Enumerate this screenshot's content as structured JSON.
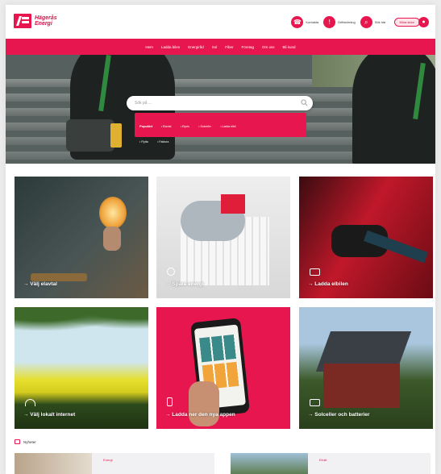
{
  "brand": {
    "logo_text": "Hägerås Energi",
    "accent": "#e8164f"
  },
  "top_links": [
    {
      "label": "Kontakta",
      "icon": "phone-icon"
    },
    {
      "label": "Driftstörning",
      "icon": "alert-icon"
    },
    {
      "label": "Sök här",
      "icon": "search-icon"
    }
  ],
  "customer_button": {
    "label": "Mina sidor",
    "icon": "user-icon"
  },
  "nav": [
    "Hem",
    "Ladda bilen",
    "Energiråd",
    "Sol",
    "Fiber",
    "Företag",
    "Om oss",
    "Bli kund"
  ],
  "search": {
    "placeholder": "Sök på ..."
  },
  "suggestions": {
    "title": "Populärt",
    "chips": [
      "• Elavtal",
      "• Elpris",
      "• Solceller",
      "• Ladda elbil",
      "• Flytta",
      "• Faktura"
    ]
  },
  "tiles": [
    {
      "label": "→ Välj elavtal",
      "icon": "bulb-icon"
    },
    {
      "label": "→ Spara energi",
      "icon": "flower-icon"
    },
    {
      "label": "→ Ladda elbilen",
      "icon": "car-icon"
    },
    {
      "label": "→ Välj lokalt internet",
      "icon": "wifi-icon"
    },
    {
      "label": "→ Ladda ner den nya appen",
      "icon": "phone-icon"
    },
    {
      "label": "→ Solceller och batterier",
      "icon": "solar-panel-icon"
    }
  ],
  "news": {
    "title": "Nyheter",
    "cards": [
      {
        "tag": "Energi"
      },
      {
        "tag": "Elnät"
      }
    ]
  }
}
